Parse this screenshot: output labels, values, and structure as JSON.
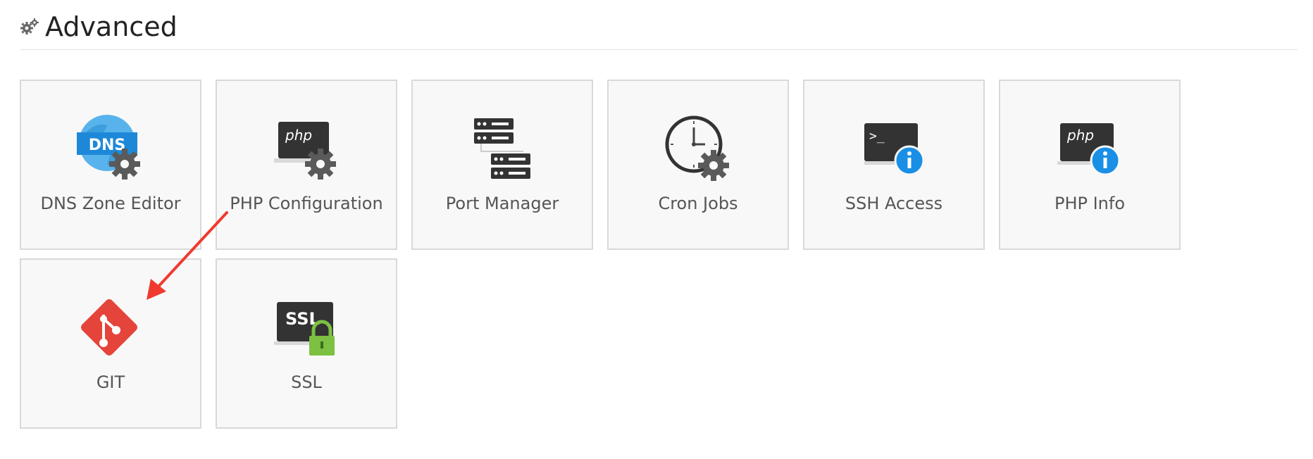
{
  "section": {
    "title": "Advanced",
    "icon": "gears-icon"
  },
  "tiles": [
    {
      "label": "DNS Zone Editor",
      "icon": "dns-zone-editor-icon",
      "icon_text": "DNS"
    },
    {
      "label": "PHP Configuration",
      "icon": "php-configuration-icon",
      "icon_text": "php"
    },
    {
      "label": "Port Manager",
      "icon": "port-manager-icon"
    },
    {
      "label": "Cron Jobs",
      "icon": "cron-jobs-icon"
    },
    {
      "label": "SSH Access",
      "icon": "ssh-access-icon",
      "icon_text": ">_"
    },
    {
      "label": "PHP Info",
      "icon": "php-info-icon",
      "icon_text": "php"
    },
    {
      "label": "GIT",
      "icon": "git-icon"
    },
    {
      "label": "SSL",
      "icon": "ssl-icon",
      "icon_text": "SSL"
    }
  ],
  "colors": {
    "tile_bg": "#f8f8f8",
    "tile_border": "#d9d9d9",
    "icon_dark": "#333333",
    "gear_gray": "#5a5a5a",
    "info_blue": "#1a8fe6",
    "dns_blue": "#2c9be0",
    "git_red": "#e5443a",
    "lock_green": "#7cc142",
    "annotation_arrow": "#f03a2e"
  },
  "annotation": {
    "type": "arrow",
    "points_to": "GIT"
  }
}
